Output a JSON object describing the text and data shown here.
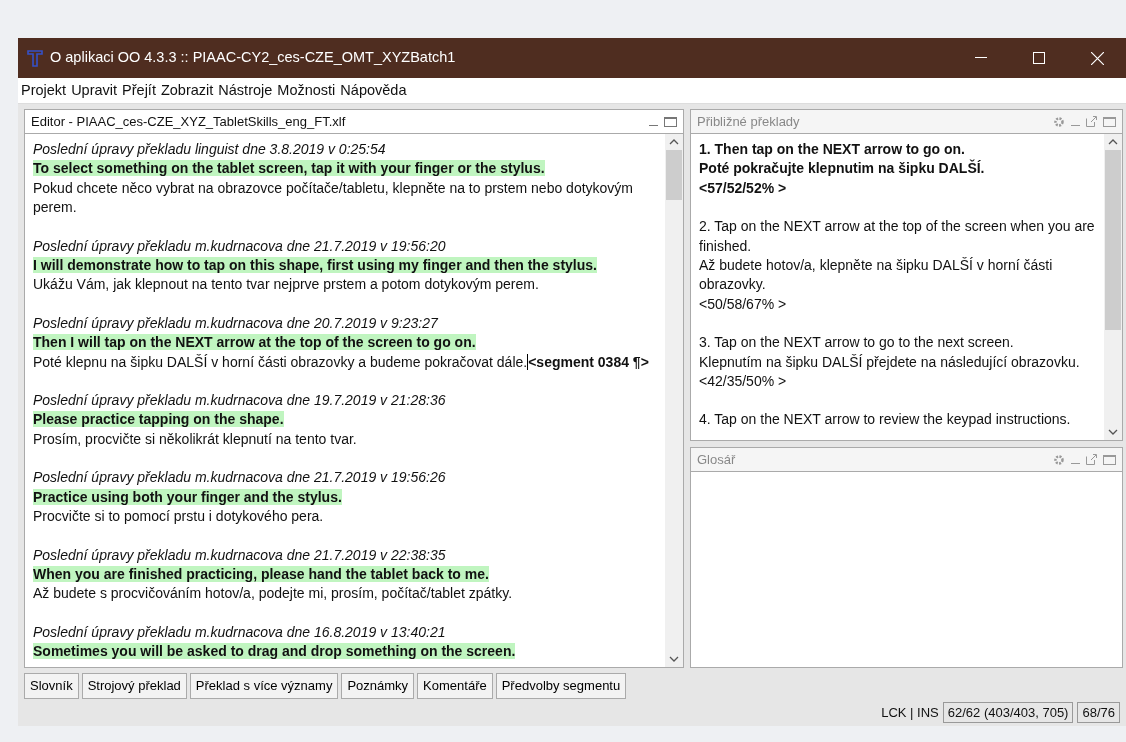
{
  "window": {
    "title": "O aplikaci OO 4.3.3 :: PIAAC-CY2_ces-CZE_OMT_XYZBatch1"
  },
  "menu": [
    "Projekt",
    "Upravit",
    "Přejít",
    "Zobrazit",
    "Nástroje",
    "Možnosti",
    "Nápověda"
  ],
  "editor": {
    "title": "Editor - PIAAC_ces-CZE_XYZ_TabletSkills_eng_FT.xlf",
    "segments": [
      {
        "meta": "Poslední úpravy překladu linguist dne 3.8.2019 v 0:25:54",
        "source": "To select something on the tablet screen, tap it with your finger or the stylus.",
        "target": "Pokud chcete něco vybrat na obrazovce počítače/tabletu, klepněte na to prstem nebo dotykovým perem."
      },
      {
        "meta": "Poslední úpravy překladu m.kudrnacova dne 21.7.2019 v 19:56:20",
        "source": "I will demonstrate how to tap on this shape, first using my finger and then the stylus.",
        "target": "Ukážu Vám, jak klepnout na tento tvar nejprve prstem a potom dotykovým perem."
      },
      {
        "meta": "Poslední úpravy překladu m.kudrnacova dne 20.7.2019 v 9:23:27",
        "source": "Then I will tap on the NEXT arrow at the top of the screen to go on.",
        "target": "Poté klepnu na šipku DALŠÍ v horní části obrazovky a budeme pokračovat dále.",
        "tag": "<segment 0384 ¶>"
      },
      {
        "meta": "Poslední úpravy překladu m.kudrnacova dne 19.7.2019 v 21:28:36",
        "source": "Please practice tapping on the shape.",
        "target": "Prosím, procvičte si několikrát klepnutí na tento tvar."
      },
      {
        "meta": "Poslední úpravy překladu m.kudrnacova dne 21.7.2019 v 19:56:26",
        "source": "Practice using both your finger and the stylus.",
        "target": "Procvičte si to pomocí prstu i dotykového pera."
      },
      {
        "meta": "Poslední úpravy překladu m.kudrnacova dne 21.7.2019 v 22:38:35",
        "source": "When you are finished practicing, please hand the tablet back to me.",
        "target": "Až budete s procvičováním hotov/a, podejte mi, prosím, počítač/tablet zpátky."
      },
      {
        "meta": "Poslední úpravy překladu m.kudrnacova dne 16.8.2019 v 13:40:21",
        "source": "Sometimes you will be asked to drag and drop something on the screen."
      }
    ]
  },
  "matches": {
    "title": "Přibližné překlady",
    "items": [
      {
        "selected": true,
        "source": "1. Then tap on the NEXT arrow to go on.",
        "target": "Poté pokračujte klepnutim na šipku DALŠÍ.",
        "score": "<57/52/52% >"
      },
      {
        "selected": false,
        "source": "2. Tap on the NEXT arrow at the top of the screen when you are finished.",
        "target": "Až budete hotov/a, klepněte na šipku DALŠÍ v horní části obrazovky.",
        "score": "<50/58/67% >"
      },
      {
        "selected": false,
        "source": "3. Tap on the NEXT arrow to go to the next screen.",
        "target": "Klepnutím na šipku DALŠÍ přejdete na následující obrazovku.",
        "score": "<42/35/50% >"
      },
      {
        "selected": false,
        "source": "4. Tap on the NEXT arrow to review the keypad instructions."
      }
    ]
  },
  "glossary": {
    "title": "Glosář"
  },
  "bottom_tabs": [
    "Slovník",
    "Strojový překlad",
    "Překlad s více významy",
    "Poznámky",
    "Komentáře",
    "Předvolby segmentu"
  ],
  "status_bar": {
    "mode": "LCK | INS",
    "progress": "62/62 (403/403, 705)",
    "segment": "68/76"
  }
}
